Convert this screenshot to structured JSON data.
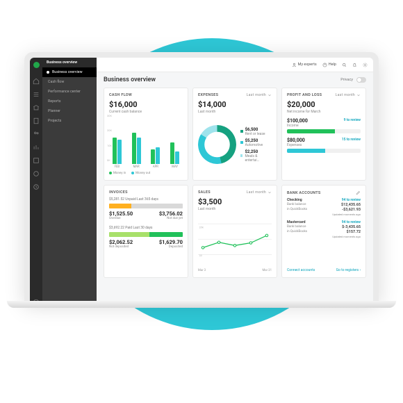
{
  "sidebar": {
    "app": "Business overview",
    "active": "Business overview",
    "items": [
      "Cash flow",
      "Performance center",
      "Reports",
      "Planner",
      "Projects"
    ]
  },
  "topbar": {
    "experts": "My experts",
    "help": "Help"
  },
  "page": {
    "title": "Business overview",
    "privacy": "Privacy"
  },
  "cashflow": {
    "title": "CASH FLOW",
    "amount": "$16,000",
    "sub": "Current cash balance",
    "legend_in": "Money in",
    "legend_out": "Money out"
  },
  "expenses": {
    "title": "EXPENSES",
    "period": "Last month",
    "amount": "$14,000",
    "sub": "Last month",
    "items": [
      {
        "value": "$6,500",
        "label": "Rent or lease",
        "color": "#16a180"
      },
      {
        "value": "$5,250",
        "label": "Automotive",
        "color": "#2ec7d6"
      },
      {
        "value": "$2,250",
        "label": "Meals & entertai…",
        "color": "#9fe3ec"
      }
    ]
  },
  "pl": {
    "title": "PROFIT AND LOSS",
    "period": "Last month",
    "amount": "$20,000",
    "sub": "Net income for March",
    "income": {
      "amount": "$100,000",
      "label": "Income",
      "review": "9 to review",
      "pct": 65,
      "color": "#21c15a"
    },
    "expense": {
      "amount": "$80,000",
      "label": "Expenses",
      "review": "15 to review",
      "pct": 52,
      "color": "#2ec7d6"
    }
  },
  "invoices": {
    "title": "INVOICES",
    "unpaid": {
      "head": "$5,281.52 Unpaid  Last 365 days",
      "a": "$1,525.50",
      "al": "Overdue",
      "b": "$3,756.02",
      "bl": "Not due yet"
    },
    "paid": {
      "head": "$3,692.22 Paid  Last 30 days",
      "a": "$2,062.52",
      "al": "Not deposited",
      "b": "$1,629.70",
      "bl": "Deposited"
    }
  },
  "sales": {
    "title": "SALES",
    "period": "Last month",
    "amount": "$3,500",
    "sub": "Last month",
    "xlabels": [
      "Mar 3",
      "Mar 31"
    ]
  },
  "bank": {
    "title": "BANK ACCOUNTS",
    "accounts": [
      {
        "name": "Checking",
        "review": "94 to review",
        "l1": "Bank balance",
        "v1": "$12,435.65",
        "l2": "in QuickBooks",
        "v2": "-$3,621.93",
        "ago": "Updated moments ago"
      },
      {
        "name": "Mastercard",
        "review": "94 to review",
        "l1": "Bank balance",
        "v1": "$-3,435.65",
        "l2": "in QuickBooks",
        "v2": "$157.72",
        "ago": "Updated moments ago"
      }
    ],
    "link1": "Connect accounts",
    "link2": "Go to registers ›"
  },
  "chart_data": [
    {
      "type": "bar",
      "title": "Cash Flow",
      "ylim": [
        0,
        30000
      ],
      "yticks": [
        "30K",
        "20K",
        "10K",
        "0K"
      ],
      "categories": [
        "FEB",
        "MAR",
        "APR",
        "MAY"
      ],
      "series": [
        {
          "name": "Money in",
          "color": "#21c15a",
          "values": [
            22000,
            26000,
            12000,
            18000
          ]
        },
        {
          "name": "Money out",
          "color": "#2ec7d6",
          "values": [
            20000,
            22000,
            14000,
            10000
          ]
        }
      ]
    },
    {
      "type": "pie",
      "title": "Expenses",
      "series": [
        {
          "name": "Rent or lease",
          "value": 6500,
          "color": "#16a180"
        },
        {
          "name": "Automotive",
          "value": 5250,
          "color": "#2ec7d6"
        },
        {
          "name": "Meals & entertainment",
          "value": 2250,
          "color": "#9fe3ec"
        }
      ]
    },
    {
      "type": "bar",
      "title": "Profit and Loss",
      "series": [
        {
          "name": "Income",
          "value": 100000,
          "review": 9,
          "color": "#21c15a"
        },
        {
          "name": "Expenses",
          "value": 80000,
          "review": 15,
          "color": "#2ec7d6"
        }
      ]
    },
    {
      "type": "line",
      "title": "Sales",
      "ylim": [
        0,
        5000
      ],
      "yticks": [
        "$5K",
        "$0"
      ],
      "x": [
        "Mar 3",
        "",
        "",
        "",
        "Mar 31"
      ],
      "series": [
        {
          "name": "Sales",
          "values": [
            1200,
            2200,
            1600,
            2100,
            3500
          ],
          "color": "#21c15a"
        }
      ]
    }
  ]
}
